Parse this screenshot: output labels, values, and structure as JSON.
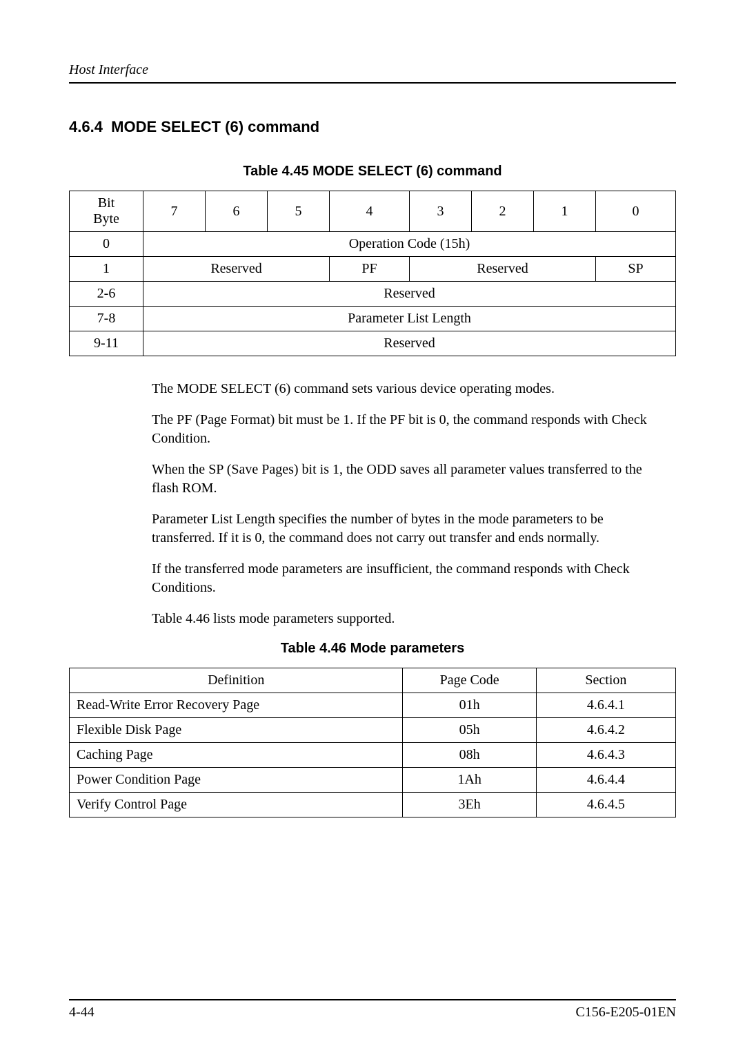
{
  "header": {
    "running_head": "Host Interface"
  },
  "section": {
    "number": "4.6.4",
    "title": "MODE SELECT (6) command"
  },
  "table45": {
    "caption": "Table 4.45 MODE SELECT (6) command",
    "corner_top": "Bit",
    "corner_bottom": "Byte",
    "bits": [
      "7",
      "6",
      "5",
      "4",
      "3",
      "2",
      "1",
      "0"
    ],
    "rows": {
      "r0": {
        "byte": "0",
        "span": "Operation Code (15h)"
      },
      "r1": {
        "byte": "1",
        "res1": "Reserved",
        "pf": "PF",
        "res2": "Reserved",
        "sp": "SP"
      },
      "r2": {
        "byte": "2-6",
        "span": "Reserved"
      },
      "r3": {
        "byte": "7-8",
        "span": "Parameter List Length"
      },
      "r4": {
        "byte": "9-11",
        "span": "Reserved"
      }
    }
  },
  "paragraphs": {
    "p1": "The MODE SELECT (6) command sets various device operating modes.",
    "p2": "The PF (Page Format) bit must be 1.  If the PF bit is 0, the command responds with Check Condition.",
    "p3": "When the SP (Save Pages) bit is 1, the ODD saves all parameter values transferred to the flash ROM.",
    "p4": "Parameter List Length specifies the number of bytes in the mode parameters to be transferred.  If it is 0, the command does not carry out transfer and ends normally.",
    "p5": "If the transferred mode parameters are insufficient, the command responds with Check Conditions.",
    "p6": "Table 4.46 lists mode parameters supported."
  },
  "table46": {
    "caption": "Table 4.46 Mode parameters",
    "headers": {
      "def": "Definition",
      "page_code": "Page Code",
      "section": "Section"
    },
    "rows": [
      {
        "def": "Read-Write Error Recovery Page",
        "page_code": "01h",
        "section": "4.6.4.1"
      },
      {
        "def": "Flexible Disk Page",
        "page_code": "05h",
        "section": "4.6.4.2"
      },
      {
        "def": "Caching Page",
        "page_code": "08h",
        "section": "4.6.4.3"
      },
      {
        "def": "Power Condition Page",
        "page_code": "1Ah",
        "section": "4.6.4.4"
      },
      {
        "def": "Verify Control Page",
        "page_code": "3Eh",
        "section": "4.6.4.5"
      }
    ]
  },
  "footer": {
    "page": "4-44",
    "doc": "C156-E205-01EN"
  },
  "chart_data": {
    "type": "table",
    "title": "Table 4.46 Mode parameters",
    "columns": [
      "Definition",
      "Page Code",
      "Section"
    ],
    "rows": [
      [
        "Read-Write Error Recovery Page",
        "01h",
        "4.6.4.1"
      ],
      [
        "Flexible Disk Page",
        "05h",
        "4.6.4.2"
      ],
      [
        "Caching Page",
        "08h",
        "4.6.4.3"
      ],
      [
        "Power Condition Page",
        "1Ah",
        "4.6.4.4"
      ],
      [
        "Verify Control Page",
        "3Eh",
        "4.6.4.5"
      ]
    ]
  }
}
